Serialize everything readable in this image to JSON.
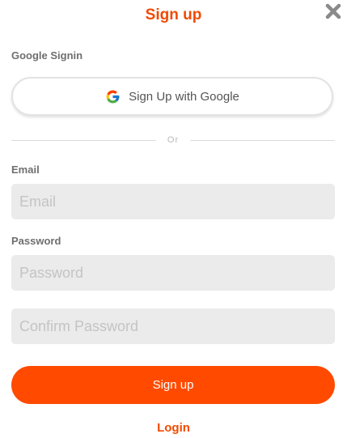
{
  "header": {
    "title": "Sign up"
  },
  "close_icon": "close-icon",
  "google_section": {
    "label": "Google Signin",
    "button_label": "Sign Up with Google",
    "icon": "google-icon"
  },
  "divider": {
    "text": "Or"
  },
  "email": {
    "label": "Email",
    "placeholder": "Email",
    "value": ""
  },
  "password": {
    "label": "Password",
    "placeholder": "Password",
    "value": ""
  },
  "confirm_password": {
    "placeholder": "Confirm Password",
    "value": ""
  },
  "actions": {
    "signup_label": "Sign up",
    "login_label": "Login"
  },
  "colors": {
    "accent": "#ff4a00",
    "field_bg": "#ebebeb",
    "label": "#6f6f6f"
  }
}
